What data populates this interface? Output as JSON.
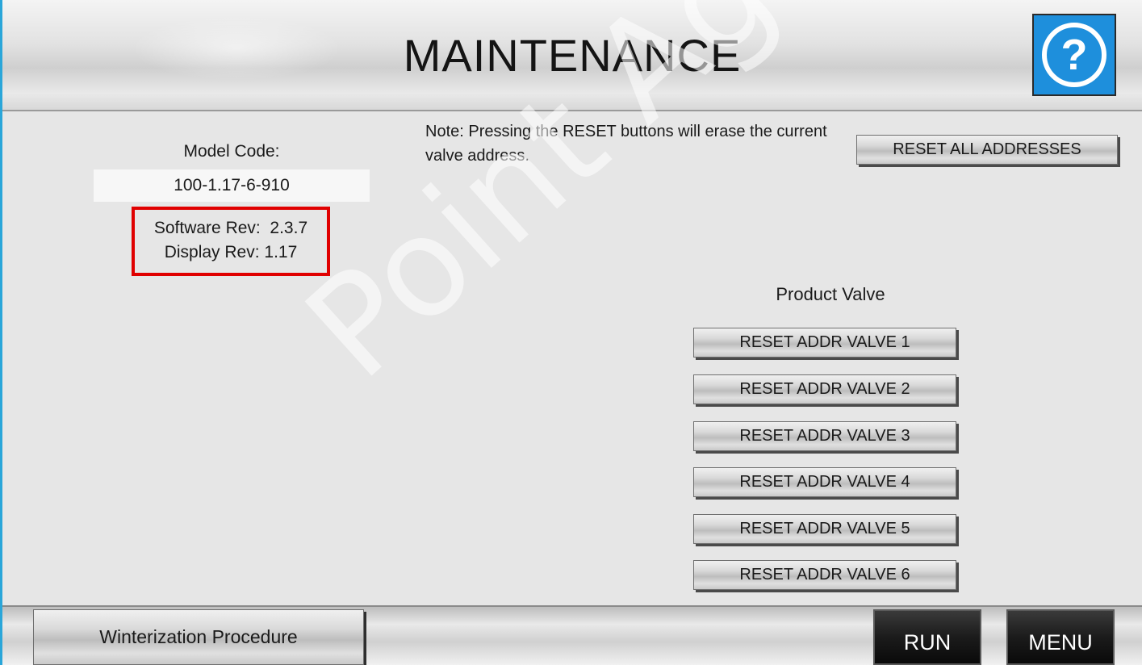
{
  "header": {
    "title": "MAINTENANCE",
    "help_icon": "help-question-icon",
    "help_glyph": "?"
  },
  "model": {
    "label": "Model Code:",
    "value": "100-1.17-6-910"
  },
  "revisions": {
    "software": "Software Rev:  2.3.7",
    "display": "Display Rev: 1.17"
  },
  "note": {
    "text": "Note: Pressing the RESET buttons will erase the current valve address."
  },
  "reset_all": {
    "label": "RESET ALL ADDRESSES"
  },
  "product_valve": {
    "label": "Product Valve",
    "buttons": [
      {
        "label": "RESET ADDR VALVE 1"
      },
      {
        "label": "RESET ADDR VALVE 2"
      },
      {
        "label": "RESET ADDR VALVE 3"
      },
      {
        "label": "RESET ADDR VALVE 4"
      },
      {
        "label": "RESET ADDR VALVE 5"
      },
      {
        "label": "RESET ADDR VALVE 6"
      }
    ]
  },
  "footer": {
    "winterization_label": "Winterization Procedure",
    "run_label": "RUN",
    "menu_label": "MENU"
  },
  "watermark": "Point Ag Syste",
  "colors": {
    "accent_blue": "#1e8fdc",
    "highlight_red": "#e00000",
    "background": "#e6e6e6"
  }
}
